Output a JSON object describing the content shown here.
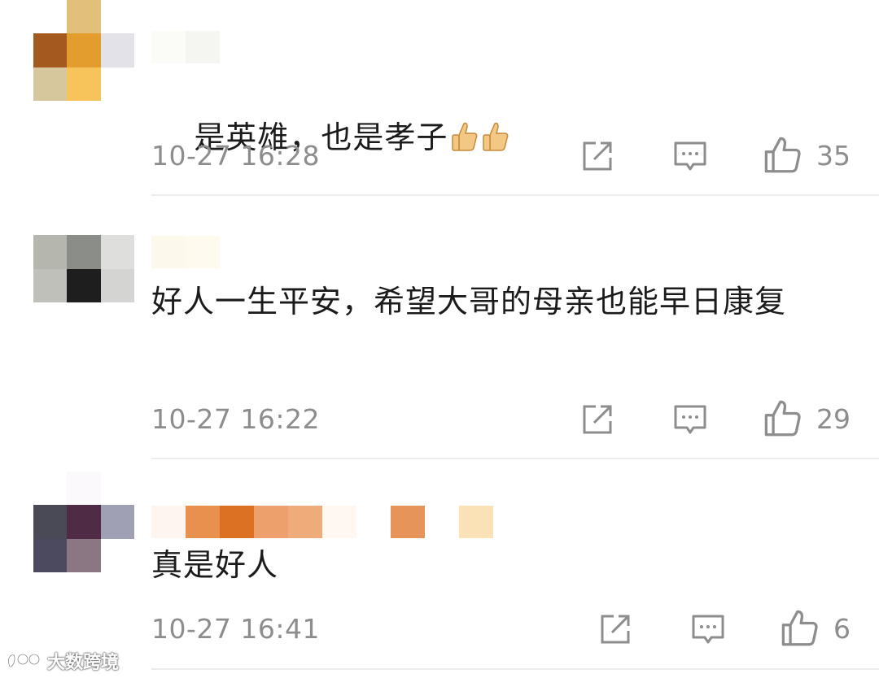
{
  "comments": [
    {
      "text": "是英雄，也是孝子",
      "emoji": [
        "thumbs-up",
        "thumbs-up"
      ],
      "time": "10-27 16:28",
      "likes": "35",
      "avatar_colors": [
        "#ffffff",
        "#e3c07a",
        "#ffffff",
        "#a45a1e",
        "#e29d2e",
        "#e2e2e8",
        "#d6c79c",
        "#f6c45a",
        "#ffffff"
      ],
      "name_colors": [
        "#fbfbf8",
        "#f5f5f2"
      ]
    },
    {
      "text": "好人一生平安，希望大哥的母亲也能早日康复",
      "time": "10-27 16:22",
      "likes": "29",
      "avatar_colors": [
        "#ffffff",
        "#ffffff",
        "#ffffff",
        "#b5b7ae",
        "#8b8d88",
        "#dedfdc",
        "#bfc0ba",
        "#1e1e1e",
        "#d4d5d2"
      ],
      "name_colors": [
        "#fcf8ec",
        "#fffaf0"
      ]
    },
    {
      "text": "真是好人",
      "time": "10-27 16:41",
      "likes": "6",
      "avatar_colors": [
        "#ffffff",
        "#fbf9fb",
        "#ffffff",
        "#4a4956",
        "#4f2b45",
        "#9fa0b4",
        "#4b4a5f",
        "#8b7684",
        "#ffffff"
      ],
      "name_colors": [
        "#fef6ee",
        "#e8914f",
        "#dd7123",
        "#eda06b",
        "#efab79",
        "#fff7f0",
        "#ffffff",
        "#e6945a",
        "#ffffff",
        "#fbe1b6"
      ]
    }
  ],
  "watermark": {
    "text": "大数跨境"
  },
  "icons": {
    "share": "share-icon",
    "reply": "comment-icon",
    "like": "like-icon"
  },
  "colors": {
    "meta_gray": "#8d8d8d",
    "divider": "#ececec"
  }
}
